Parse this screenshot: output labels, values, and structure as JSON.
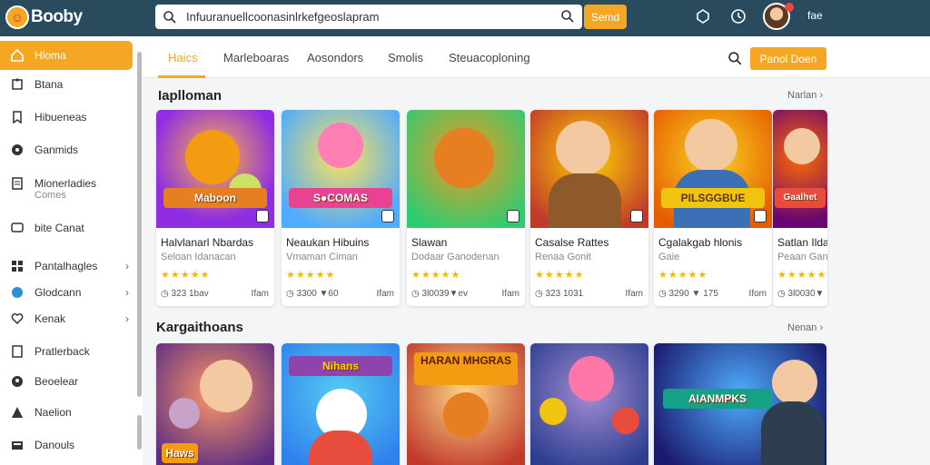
{
  "app": {
    "logo_text": "Booby"
  },
  "search": {
    "value": "Infuuranuellcoonasinlrkefgeoslapram",
    "placeholder": "",
    "button_label": "Semd"
  },
  "topbar": {
    "more_label": "fae"
  },
  "sidebar": {
    "items": [
      {
        "label": "Hloma",
        "icon": "home-icon"
      },
      {
        "label": "Btana",
        "icon": "puzzle-icon"
      },
      {
        "label": "Hibueneas",
        "icon": "bookmark-icon"
      },
      {
        "label": "Ganmids",
        "icon": "game-icon"
      },
      {
        "label": "Mionerladies",
        "sub": "Comes",
        "icon": "file-icon"
      },
      {
        "label": "bite Canat",
        "icon": "chat-icon"
      },
      {
        "label": "Pantalhagles",
        "icon": "grid-icon",
        "chevron": "›"
      },
      {
        "label": "Glodcann",
        "icon": "globe-icon",
        "chevron": "›"
      },
      {
        "label": "Kenak",
        "icon": "heart-icon",
        "chevron": "›"
      },
      {
        "label": "Pratlerback",
        "icon": "document-icon"
      },
      {
        "label": "Beoelear",
        "icon": "user-icon"
      },
      {
        "label": "Naelion",
        "icon": "triangle-icon"
      },
      {
        "label": "Danouls",
        "icon": "download-icon"
      }
    ]
  },
  "tabs": [
    {
      "label": "Haics"
    },
    {
      "label": "Marleboaras"
    },
    {
      "label": "Aosondors"
    },
    {
      "label": "Smolis"
    },
    {
      "label": "Steuacoploning"
    }
  ],
  "toolbar": {
    "primary_button": "Panol Doen"
  },
  "sections": [
    {
      "title": "Iaplloman",
      "more": "Narlan ›",
      "cards": [
        {
          "title": "Halvlanarl Nbardas",
          "sub": "Seloan Idanacan",
          "stars": "★★★★★",
          "foot_left": "◷ 323 1bav",
          "foot_right": "Ifam",
          "banner": "Maboon"
        },
        {
          "title": "Neaukan Hibuins",
          "sub": "Vmaman Ciman",
          "stars": "★★★★★",
          "foot_left": "◷ 3300 ▼60",
          "foot_right": "Ifam",
          "banner": "S●COMAS"
        },
        {
          "title": "Slawan",
          "sub": "Dodaar Ganodenan",
          "stars": "★★★★★",
          "foot_left": "◷ 3l0039▼ev",
          "foot_right": "Ifam",
          "banner": ""
        },
        {
          "title": "Casalse Rattes",
          "sub": "Renaa Gonit",
          "stars": "★★★★★",
          "foot_left": "◷ 323 1031",
          "foot_right": "Ifam",
          "banner": ""
        },
        {
          "title": "Cgalakgab hlonis",
          "sub": "Gaie",
          "stars": "★★★★★",
          "foot_left": "◷ 3290 ▼ 175",
          "foot_right": "Ifom",
          "banner": "PILSGGBUE"
        },
        {
          "title": "Satlan Ilda",
          "sub": "Peaan Gan",
          "stars": "★★★★★",
          "foot_left": "◷ 3l0030▼",
          "foot_right": "",
          "banner": "Gaalhet"
        }
      ]
    },
    {
      "title": "Kargaithoans",
      "more": "Nenan ›",
      "cards": [
        {
          "banner": "Haws"
        },
        {
          "banner": "Nihans"
        },
        {
          "banner": "HARAN MHGRAS"
        },
        {
          "banner": ""
        },
        {
          "banner": "AIANMPKS"
        }
      ]
    }
  ],
  "colors": {
    "accent": "#f5a623",
    "topbar": "#2a4a5e",
    "star": "#f5b800"
  }
}
